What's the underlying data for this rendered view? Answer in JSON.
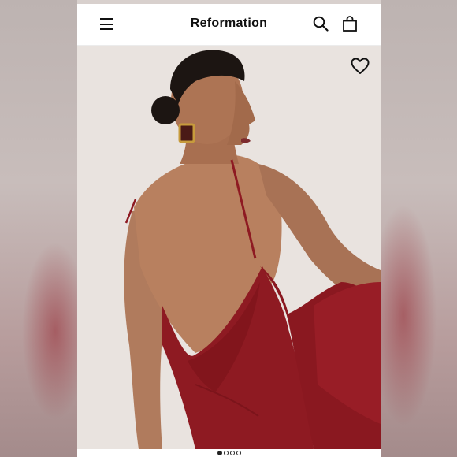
{
  "header": {
    "brand": "Reformation",
    "icons": {
      "menu": "menu-icon",
      "search": "search-icon",
      "bag": "bag-icon"
    }
  },
  "product_image": {
    "icons": {
      "favorite": "heart-icon"
    },
    "colors": {
      "dress": "#8e1a22",
      "background": "#e9e3df"
    }
  },
  "carousel": {
    "total": 4,
    "active_index": 0
  }
}
